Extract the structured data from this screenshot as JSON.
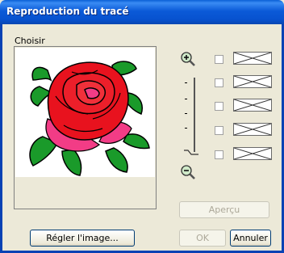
{
  "window": {
    "title": "Reproduction du tracé"
  },
  "left_panel": {
    "label": "Choisir"
  },
  "buttons": {
    "adjust_image": "Régler l'image...",
    "preview": "Aperçu",
    "ok": "OK",
    "cancel": "Annuler"
  },
  "zoom": {
    "zoom_in_icon": "zoom-in-magnifier-icon",
    "zoom_out_icon": "zoom-out-magnifier-icon"
  },
  "options": [
    {
      "checked": false,
      "icon": "empty-crossed-box"
    },
    {
      "checked": false,
      "icon": "empty-crossed-box"
    },
    {
      "checked": false,
      "icon": "empty-crossed-box"
    },
    {
      "checked": false,
      "icon": "empty-crossed-box"
    },
    {
      "checked": false,
      "icon": "empty-crossed-box"
    }
  ],
  "colors": {
    "title_bar": "#0b5ad8",
    "dialog_bg": "#ece9d8",
    "rose_red": "#e8121e",
    "rose_pink": "#f23c86",
    "leaf_green": "#1a9a2a"
  }
}
